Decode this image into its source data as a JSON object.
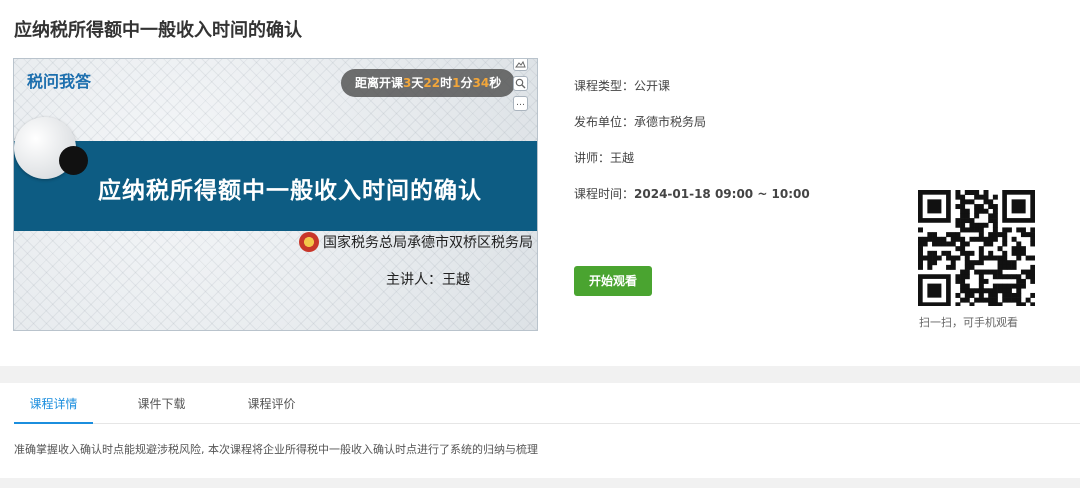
{
  "course": {
    "title": "应纳税所得额中一般收入时间的确认"
  },
  "player": {
    "brand": "税问我答",
    "countdown": {
      "prefix": "距离开课",
      "days": "3",
      "days_unit": "天",
      "hours": "22",
      "hours_unit": "时",
      "minutes": "1",
      "minutes_unit": "分",
      "seconds": "34",
      "seconds_unit": "秒"
    },
    "banner_title": "应纳税所得额中一般收入时间的确认",
    "organization": "国家税务总局承德市双桥区税务局",
    "speaker": "主讲人：王越",
    "tools": [
      "image-icon",
      "zoom-icon",
      "more-icon"
    ]
  },
  "info": {
    "type": {
      "label": "课程类型：",
      "value": "公开课"
    },
    "publisher": {
      "label": "发布单位：",
      "value": "承德市税务局"
    },
    "lecturer": {
      "label": "讲师：",
      "value": "王越"
    },
    "time": {
      "label": "课程时间：",
      "value": "2024-01-18 09:00 ~ 10:00"
    },
    "watch_button": "开始观看"
  },
  "qr": {
    "caption": "扫一扫，可手机观看"
  },
  "tabs": [
    {
      "label": "课程详情",
      "active": true
    },
    {
      "label": "课件下载",
      "active": false
    },
    {
      "label": "课程评价",
      "active": false
    }
  ],
  "description": "准确掌握收入确认时点能规避涉税风险, 本次课程将企业所得税中一般收入确认时点进行了系统的归纳与梳理",
  "colors": {
    "accent": "#1b8ede",
    "button": "#4aa430",
    "banner": "#0d5c83",
    "countdown_number": "#f2a63a"
  }
}
